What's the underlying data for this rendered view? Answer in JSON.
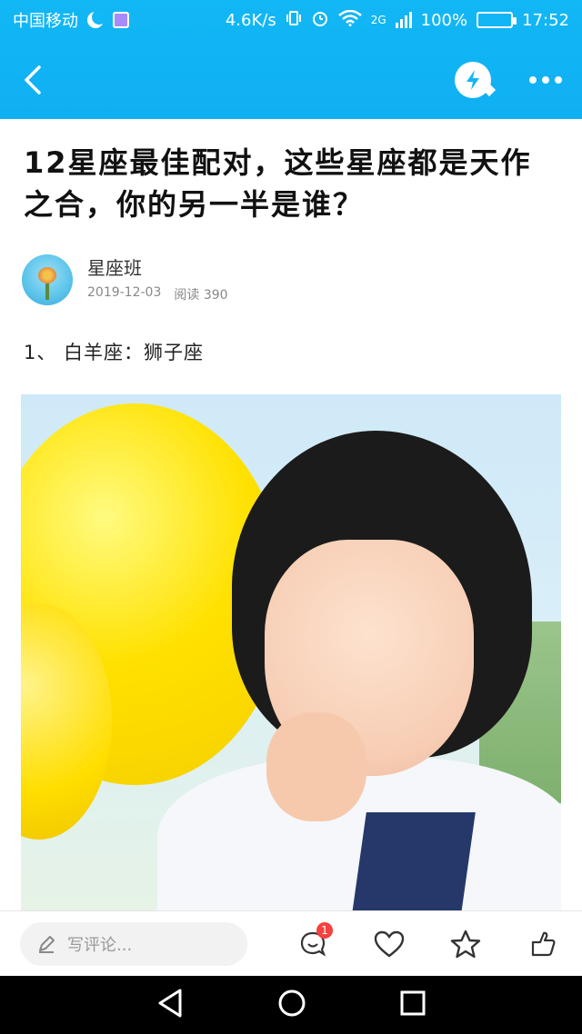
{
  "status_bar": {
    "carrier": "中国移动",
    "speed": "4.6K/s",
    "network": "2G",
    "battery_percent": "100%",
    "time": "17:52"
  },
  "nav": {
    "back_icon": "chevron-left-icon",
    "lightning_icon": "lightning-icon",
    "more_icon": "more-icon"
  },
  "article": {
    "title": "12星座最佳配对，这些星座都是天作之合，你的另一半是谁？",
    "author": "星座班",
    "date": "2019-12-03",
    "read_label": "阅读",
    "read_count": "390",
    "section_heading": "1、 白羊座：狮子座"
  },
  "bottom_bar": {
    "comment_placeholder": "写评论...",
    "comment_badge": "1"
  },
  "colors": {
    "accent": "#12b7f5",
    "badge": "#f5423f"
  }
}
